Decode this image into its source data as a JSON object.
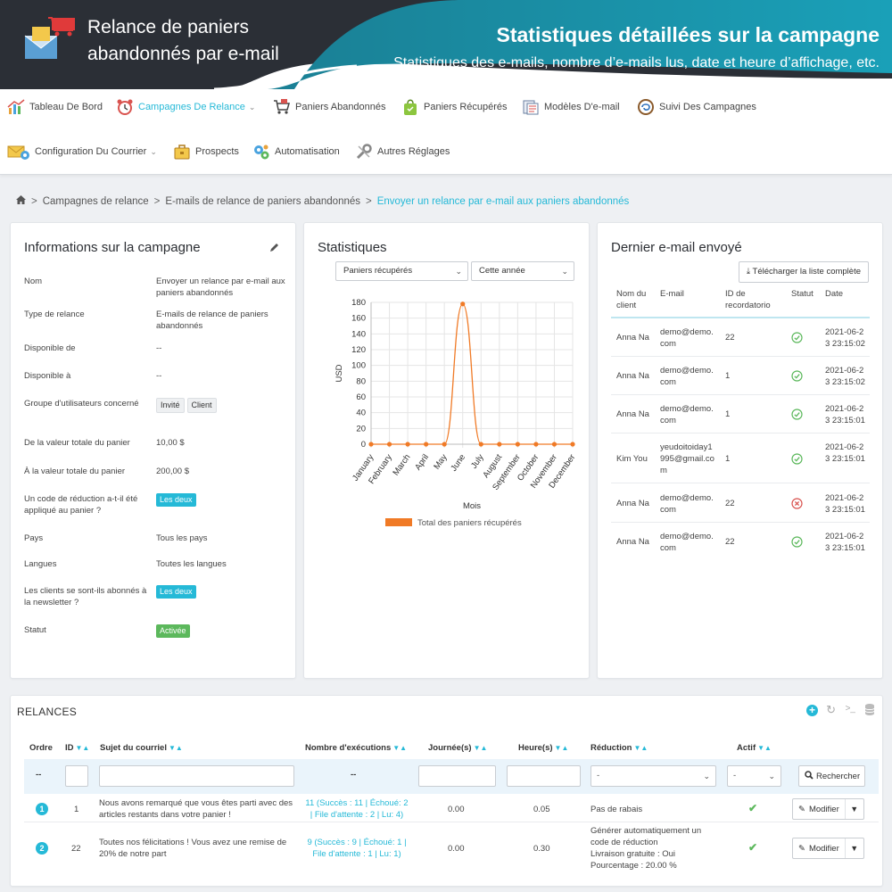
{
  "banner": {
    "title_line1": "Relance de paniers",
    "title_line2": "abandonnés par e-mail",
    "headline": "Statistiques détaillées sur la campagne",
    "subheadline": "Statistiques des e-mails, nombre d’e-mails lus, date et heure d’affichage, etc."
  },
  "nav": {
    "items": [
      {
        "label": "Tableau De Bord",
        "icon": "bar-chart-icon"
      },
      {
        "label": "Campagnes De Relance",
        "icon": "alarm-clock-icon",
        "active": true
      },
      {
        "label": "Paniers Abandonnés",
        "icon": "cart-icon"
      },
      {
        "label": "Paniers Récupérés",
        "icon": "shopping-bag-icon"
      },
      {
        "label": "Modèles D'e-mail",
        "icon": "email-templates-icon"
      },
      {
        "label": "Suivi Des Campagnes",
        "icon": "campaign-tracking-icon"
      },
      {
        "label": "Configuration Du Courrier",
        "icon": "mail-config-icon"
      },
      {
        "label": "Prospects",
        "icon": "briefcase-icon"
      },
      {
        "label": "Automatisation",
        "icon": "gears-icon"
      },
      {
        "label": "Autres Réglages",
        "icon": "wrench-icon"
      }
    ]
  },
  "breadcrumb": {
    "items": [
      "Campagnes de relance",
      "E-mails de relance de paniers abandonnés"
    ],
    "current": "Envoyer un relance par e-mail aux paniers abandonnés"
  },
  "info": {
    "title": "Informations sur la campagne",
    "rows": [
      {
        "label": "Nom",
        "value": "Envoyer un relance par e-mail aux paniers abandonnés"
      },
      {
        "label": "Type de relance",
        "value": "E-mails de relance de paniers abandonnés"
      },
      {
        "label": "Disponible de",
        "value": "--"
      },
      {
        "label": "Disponible à",
        "value": "--"
      },
      {
        "label": "Groupe d'utilisateurs concerné",
        "tags": [
          "Invité",
          "Client"
        ]
      },
      {
        "label": "De la valeur totale du panier",
        "value": "10,00 $"
      },
      {
        "label": "À la valeur totale du panier",
        "value": "200,00 $"
      },
      {
        "label": "Un code de réduction a-t-il été appliqué au panier ?",
        "badge": "Les deux"
      },
      {
        "label": "Pays",
        "value": "Tous les pays"
      },
      {
        "label": "Langues",
        "value": "Toutes les langues"
      },
      {
        "label": "Les clients se sont-ils abonnés à la newsletter ?",
        "badge": "Les deux"
      },
      {
        "label": "Statut",
        "status": "Activée"
      }
    ]
  },
  "stats": {
    "title": "Statistiques",
    "select_metric": "Paniers récupérés",
    "select_period": "Cette année"
  },
  "chart_data": {
    "type": "line",
    "categories": [
      "January",
      "February",
      "March",
      "April",
      "May",
      "June",
      "July",
      "August",
      "September",
      "October",
      "November",
      "December"
    ],
    "series": [
      {
        "name": "Total des paniers récupérés",
        "values": [
          0,
          0,
          0,
          0,
          0,
          178,
          0,
          0,
          0,
          0,
          0,
          0
        ],
        "color": "#f07a26"
      }
    ],
    "xlabel": "Mois",
    "ylabel": "USD",
    "ylim": [
      0,
      180
    ],
    "yticks": [
      0,
      20,
      40,
      60,
      80,
      100,
      120,
      140,
      160,
      180
    ],
    "grid": true,
    "legend": "bottom"
  },
  "last_email": {
    "title": "Dernier e-mail envoyé",
    "download_label": "Télécharger la liste complète",
    "headers": {
      "name": "Nom du client",
      "email": "E-mail",
      "id": "ID de recordatorio",
      "status": "Statut",
      "date": "Date"
    },
    "rows": [
      {
        "name": "Anna Na",
        "email": "demo@demo.com",
        "id": "22",
        "status": "ok",
        "date": "2021-06-23 23:15:02"
      },
      {
        "name": "Anna Na",
        "email": "demo@demo.com",
        "id": "1",
        "status": "ok",
        "date": "2021-06-23 23:15:02"
      },
      {
        "name": "Anna Na",
        "email": "demo@demo.com",
        "id": "1",
        "status": "ok",
        "date": "2021-06-23 23:15:01"
      },
      {
        "name": "Kim You",
        "email": "yeudoitoiday1995@gmail.com",
        "id": "1",
        "status": "ok",
        "date": "2021-06-23 23:15:01"
      },
      {
        "name": "Anna Na",
        "email": "demo@demo.com",
        "id": "22",
        "status": "fail",
        "date": "2021-06-23 23:15:01"
      },
      {
        "name": "Anna Na",
        "email": "demo@demo.com",
        "id": "22",
        "status": "ok",
        "date": "2021-06-23 23:15:01"
      }
    ],
    "colors": {
      "ok": "#5cb85c",
      "fail": "#d9534f"
    }
  },
  "relances": {
    "title": "RELANCES",
    "headers": {
      "order": "Ordre",
      "id": "ID",
      "subject": "Sujet du courriel",
      "exec": "Nombre d'exécutions",
      "days": "Journée(s)",
      "hours": "Heure(s)",
      "reduction": "Réduction",
      "active": "Actif"
    },
    "filters": {
      "order": "--",
      "exec": "--",
      "reduction": "-",
      "active": "-",
      "search": "Rechercher"
    },
    "rows": [
      {
        "order": "1",
        "id": "1",
        "subject": "Nous avons remarqué que vous êtes parti avec des articles restants dans votre panier !",
        "exec_line1": "11 (Succès : 11 | Échoué: 2",
        "exec_line2": "| File d'attente : 2 | Lu: 4)",
        "days": "0.00",
        "hours": "0.05",
        "reduction": [
          "Pas de rabais"
        ],
        "edit": "Modifier"
      },
      {
        "order": "2",
        "id": "22",
        "subject": "Toutes nos félicitations ! Vous avez une remise de 20% de notre part",
        "exec_line1": "9 (Succès : 9 | Échoué: 1 |",
        "exec_line2": "File d'attente : 1 | Lu: 1)",
        "days": "0.00",
        "hours": "0.30",
        "reduction": [
          "Générer automatiquement un",
          "code de réduction",
          "Livraison gratuite : Oui",
          "Pourcentage : 20.00 %"
        ],
        "edit": "Modifier"
      }
    ]
  },
  "colors": {
    "accent": "#25b9d7",
    "banner_dark": "#2b2f36",
    "banner_teal": "#1a8fa5"
  }
}
